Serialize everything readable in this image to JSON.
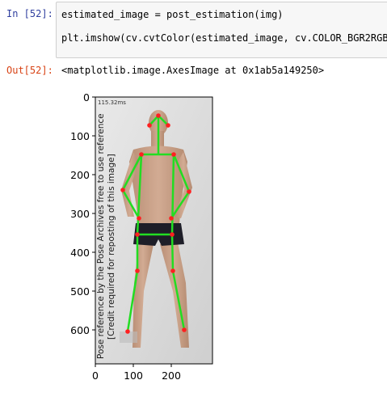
{
  "cells": {
    "in_prompt": "In [52]:",
    "code_line_1": "estimated_image = post_estimation(img)",
    "code_line_2": "plt.imshow(cv.cvtColor(estimated_image, cv.COLOR_BGR2RGB))",
    "out_prompt": "Out[52]:",
    "out_text": "<matplotlib.image.AxesImage at 0x1ab5a149250>"
  },
  "plot": {
    "timing_label": "115.32ms",
    "watermark_line1": "Pose reference by the Pose Archives free to use reference",
    "watermark_line2": "[Credit required for reposting of this image]",
    "y_ticks": [
      "0",
      "100",
      "200",
      "300",
      "400",
      "500",
      "600"
    ],
    "x_ticks": [
      "0",
      "100",
      "200"
    ],
    "keypoint_color": "#ff2020",
    "limb_color": "#22dd22"
  }
}
